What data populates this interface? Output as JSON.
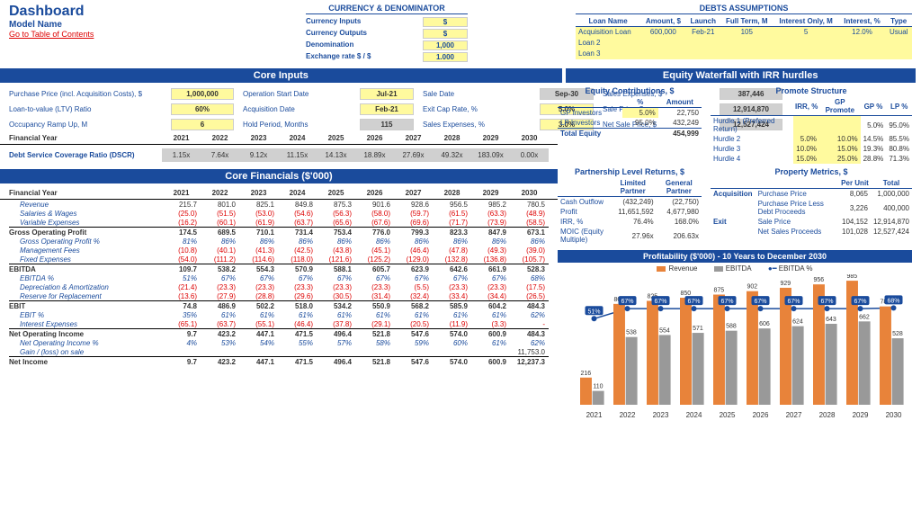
{
  "header": {
    "dashboard": "Dashboard",
    "model_name": "Model Name",
    "toc": "Go to Table of Contents"
  },
  "currency": {
    "title": "CURRENCY & DENOMINATOR",
    "rows": [
      {
        "label": "Currency Inputs",
        "val": "$"
      },
      {
        "label": "Currency Outputs",
        "val": "$"
      },
      {
        "label": "Denomination",
        "val": "1,000"
      },
      {
        "label": "Exchange rate $ / $",
        "val": "1.000"
      }
    ]
  },
  "debts": {
    "title": "DEBTS ASSUMPTIONS",
    "headers": [
      "Loan Name",
      "Amount, $",
      "Launch",
      "Full Term, M",
      "Interest Only, M",
      "Interest, %",
      "Type"
    ],
    "rows": [
      {
        "name": "Acquisition Loan",
        "amount": "600,000",
        "launch": "Feb-21",
        "term": "105",
        "io": "5",
        "int": "12.0%",
        "type": "Usual"
      },
      {
        "name": "Loan 2",
        "amount": "",
        "launch": "",
        "term": "",
        "io": "",
        "int": "",
        "type": ""
      },
      {
        "name": "Loan 3",
        "amount": "",
        "launch": "",
        "term": "",
        "io": "",
        "int": "",
        "type": ""
      }
    ]
  },
  "sections": {
    "core_inputs": "Core Inputs",
    "core_fin": "Core Financials ($'000)",
    "waterfall": "Equity Waterfall with IRR hurdles",
    "profit": "Profitability ($'000) - 10 Years to December 2030"
  },
  "inputs": {
    "r1": [
      {
        "l": "Purchase Price (incl. Acquisition Costs), $",
        "v": "1,000,000",
        "cls": ""
      },
      {
        "l": "Operation Start Date",
        "v": "Jul-21",
        "cls": ""
      },
      {
        "l": "Sale Date",
        "v": "Sep-30",
        "cls": "gray"
      },
      {
        "l": "Sales Expenses, $",
        "v": "387,446",
        "cls": "gray"
      }
    ],
    "r2": [
      {
        "l": "Loan-to-value (LTV) Ratio",
        "v": "60%",
        "cls": ""
      },
      {
        "l": "Acquisition Date",
        "v": "Feb-21",
        "cls": ""
      },
      {
        "l": "Exit Cap Rate, %",
        "v": "5.0%",
        "cls": ""
      },
      {
        "l": "Sale Price, $",
        "v": "12,914,870",
        "cls": "gray"
      }
    ],
    "r3": [
      {
        "l": "Occupancy Ramp Up, M",
        "v": "6",
        "cls": ""
      },
      {
        "l": "Hold Period, Months",
        "v": "115",
        "cls": "gray"
      },
      {
        "l": "Sales Expenses, %",
        "v": "3.0%",
        "cls": ""
      },
      {
        "l": "Net Sale Price, $",
        "v": "12,527,424",
        "cls": "gray"
      }
    ]
  },
  "years": [
    "2021",
    "2022",
    "2023",
    "2024",
    "2025",
    "2026",
    "2027",
    "2028",
    "2029",
    "2030"
  ],
  "fy_label": "Financial Year",
  "dscr_label": "Debt Service Coverage Ratio (DSCR)",
  "dscr": [
    "1.15x",
    "7.64x",
    "9.12x",
    "11.15x",
    "14.13x",
    "18.89x",
    "27.69x",
    "49.32x",
    "183.09x",
    "0.00x"
  ],
  "financials": [
    {
      "label": "Revenue",
      "vals": [
        "215.7",
        "801.0",
        "825.1",
        "849.8",
        "875.3",
        "901.6",
        "928.6",
        "956.5",
        "985.2",
        "780.5"
      ],
      "cls": "indent"
    },
    {
      "label": "Salaries & Wages",
      "vals": [
        "(25.0)",
        "(51.5)",
        "(53.0)",
        "(54.6)",
        "(56.3)",
        "(58.0)",
        "(59.7)",
        "(61.5)",
        "(63.3)",
        "(48.9)"
      ],
      "cls": "indent neg"
    },
    {
      "label": "Variable Expenses",
      "vals": [
        "(16.2)",
        "(60.1)",
        "(61.9)",
        "(63.7)",
        "(65.6)",
        "(67.6)",
        "(69.6)",
        "(71.7)",
        "(73.9)",
        "(58.5)"
      ],
      "cls": "indent neg"
    },
    {
      "label": "Gross Operating Profit",
      "vals": [
        "174.5",
        "689.5",
        "710.1",
        "731.4",
        "753.4",
        "776.0",
        "799.3",
        "823.3",
        "847.9",
        "673.1"
      ],
      "cls": "bold border-top"
    },
    {
      "label": "Gross Operating Profit %",
      "vals": [
        "81%",
        "86%",
        "86%",
        "86%",
        "86%",
        "86%",
        "86%",
        "86%",
        "86%",
        "86%"
      ],
      "cls": "indent ital"
    },
    {
      "label": "Management Fees",
      "vals": [
        "(10.8)",
        "(40.1)",
        "(41.3)",
        "(42.5)",
        "(43.8)",
        "(45.1)",
        "(46.4)",
        "(47.8)",
        "(49.3)",
        "(39.0)"
      ],
      "cls": "indent neg"
    },
    {
      "label": "Fixed Expenses",
      "vals": [
        "(54.0)",
        "(111.2)",
        "(114.6)",
        "(118.0)",
        "(121.6)",
        "(125.2)",
        "(129.0)",
        "(132.8)",
        "(136.8)",
        "(105.7)"
      ],
      "cls": "indent neg"
    },
    {
      "label": "EBITDA",
      "vals": [
        "109.7",
        "538.2",
        "554.3",
        "570.9",
        "588.1",
        "605.7",
        "623.9",
        "642.6",
        "661.9",
        "528.3"
      ],
      "cls": "bold border-top"
    },
    {
      "label": "EBITDA %",
      "vals": [
        "51%",
        "67%",
        "67%",
        "67%",
        "67%",
        "67%",
        "67%",
        "67%",
        "67%",
        "68%"
      ],
      "cls": "indent ital"
    },
    {
      "label": "Depreciation & Amortization",
      "vals": [
        "(21.4)",
        "(23.3)",
        "(23.3)",
        "(23.3)",
        "(23.3)",
        "(23.3)",
        "(5.5)",
        "(23.3)",
        "(23.3)",
        "(17.5)"
      ],
      "cls": "indent neg"
    },
    {
      "label": "Reserve for Replacement",
      "vals": [
        "(13.6)",
        "(27.9)",
        "(28.8)",
        "(29.6)",
        "(30.5)",
        "(31.4)",
        "(32.4)",
        "(33.4)",
        "(34.4)",
        "(26.5)"
      ],
      "cls": "indent neg"
    },
    {
      "label": "EBIT",
      "vals": [
        "74.8",
        "486.9",
        "502.2",
        "518.0",
        "534.2",
        "550.9",
        "568.2",
        "585.9",
        "604.2",
        "484.3"
      ],
      "cls": "bold border-top"
    },
    {
      "label": "EBIT %",
      "vals": [
        "35%",
        "61%",
        "61%",
        "61%",
        "61%",
        "61%",
        "61%",
        "61%",
        "61%",
        "62%"
      ],
      "cls": "indent ital"
    },
    {
      "label": "Interest Expenses",
      "vals": [
        "(65.1)",
        "(63.7)",
        "(55.1)",
        "(46.4)",
        "(37.8)",
        "(29.1)",
        "(20.5)",
        "(11.9)",
        "(3.3)",
        "-"
      ],
      "cls": "indent neg"
    },
    {
      "label": "Net Operating Income",
      "vals": [
        "9.7",
        "423.2",
        "447.1",
        "471.5",
        "496.4",
        "521.8",
        "547.6",
        "574.0",
        "600.9",
        "484.3"
      ],
      "cls": "bold border-top"
    },
    {
      "label": "Net Operating Income %",
      "vals": [
        "4%",
        "53%",
        "54%",
        "55%",
        "57%",
        "58%",
        "59%",
        "60%",
        "61%",
        "62%"
      ],
      "cls": "indent ital"
    },
    {
      "label": "Gain / (loss) on sale",
      "vals": [
        "",
        "",
        "",
        "",
        "",
        "",
        "",
        "",
        "",
        "11,753.0"
      ],
      "cls": "indent"
    },
    {
      "label": "Net Income",
      "vals": [
        "9.7",
        "423.2",
        "447.1",
        "471.5",
        "496.4",
        "521.8",
        "547.6",
        "574.0",
        "600.9",
        "12,237.3"
      ],
      "cls": "bold border-top"
    }
  ],
  "equity_contrib": {
    "title": "Equity Contributions, $",
    "headers": [
      "",
      "%",
      "Amount"
    ],
    "rows": [
      {
        "n": "GP Investors",
        "p": "5.0%",
        "a": "22,750",
        "ylw": true
      },
      {
        "n": "LP Investors",
        "p": "95.0%",
        "a": "432,249",
        "ylw": false
      },
      {
        "n": "Total Equity",
        "p": "",
        "a": "454,999",
        "bold": true
      }
    ]
  },
  "promote": {
    "title": "Promote Structure",
    "headers": [
      "",
      "IRR, %",
      "GP Promote",
      "GP %",
      "LP %"
    ],
    "rows": [
      {
        "n": "Hurdle 1 (Preferred Return)",
        "irr": "",
        "gpp": "",
        "gp": "5.0%",
        "lp": "95.0%"
      },
      {
        "n": "Hurdle 2",
        "irr": "5.0%",
        "gpp": "10.0%",
        "gp": "14.5%",
        "lp": "85.5%"
      },
      {
        "n": "Hurdle 3",
        "irr": "10.0%",
        "gpp": "15.0%",
        "gp": "19.3%",
        "lp": "80.8%"
      },
      {
        "n": "Hurdle 4",
        "irr": "15.0%",
        "gpp": "25.0%",
        "gp": "28.8%",
        "lp": "71.3%"
      }
    ]
  },
  "partnership": {
    "title": "Partnership Level Returns, $",
    "headers": [
      "",
      "Limited Partner",
      "General Partner"
    ],
    "rows": [
      {
        "n": "Cash Outflow",
        "lp": "(432,249)",
        "gp": "(22,750)"
      },
      {
        "n": "Profit",
        "lp": "11,651,592",
        "gp": "4,677,980"
      },
      {
        "n": "IRR, %",
        "lp": "76.4%",
        "gp": "168.0%"
      },
      {
        "n": "MOIC (Equity Multiple)",
        "lp": "27.96x",
        "gp": "206.63x"
      }
    ]
  },
  "property": {
    "title": "Property Metrics, $",
    "headers": [
      "",
      "",
      "Per Unit",
      "Total"
    ],
    "rows": [
      {
        "s": "Acquisition",
        "n": "Purchase Price",
        "pu": "8,065",
        "t": "1,000,000"
      },
      {
        "s": "",
        "n": "Purchase Price Less Debt Proceeds",
        "pu": "3,226",
        "t": "400,000"
      },
      {
        "s": "Exit",
        "n": "Sale Price",
        "pu": "104,152",
        "t": "12,914,870"
      },
      {
        "s": "",
        "n": "Net Sales Proceeds",
        "pu": "101,028",
        "t": "12,527,424"
      }
    ]
  },
  "chart_data": {
    "type": "bar",
    "title": "Profitability ($'000) - 10 Years to December 2030",
    "categories": [
      "2021",
      "2022",
      "2023",
      "2024",
      "2025",
      "2026",
      "2027",
      "2028",
      "2029",
      "2030"
    ],
    "series": [
      {
        "name": "Revenue",
        "values": [
          216,
          801,
          825,
          850,
          875,
          902,
          929,
          956,
          985,
          781
        ],
        "color": "#e8833a"
      },
      {
        "name": "EBITDA",
        "values": [
          110,
          538,
          554,
          571,
          588,
          606,
          624,
          643,
          662,
          528
        ],
        "color": "#999999"
      }
    ],
    "line": {
      "name": "EBITDA %",
      "values": [
        51,
        67,
        67,
        67,
        67,
        67,
        67,
        67,
        67,
        68
      ],
      "color": "#1a4b9c"
    },
    "ylim": [
      0,
      1000
    ]
  },
  "legend": {
    "rev": "Revenue",
    "ebitda": "EBITDA",
    "pct": "EBITDA %"
  }
}
